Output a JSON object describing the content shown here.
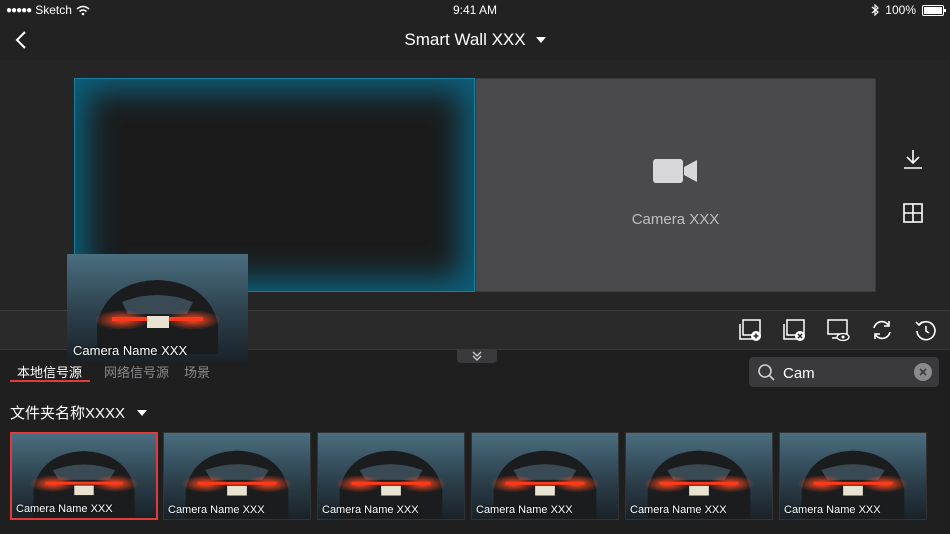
{
  "status": {
    "carrier": "Sketch",
    "time": "9:41 AM",
    "battery": "100%"
  },
  "nav": {
    "title": "Smart Wall XXX"
  },
  "wall": {
    "screen2_label": "Camera XXX"
  },
  "drag": {
    "label": "Camera Name XXX"
  },
  "tabs": [
    {
      "label": "本地信号源",
      "active": true
    },
    {
      "label": "网络信号源",
      "active": false
    },
    {
      "label": "场景",
      "active": false
    }
  ],
  "search": {
    "value": "Cam"
  },
  "folder": {
    "name": "文件夹名称XXXX"
  },
  "thumbnails": [
    {
      "label": "Camera Name XXX",
      "selected": true
    },
    {
      "label": "Camera Name XXX",
      "selected": false
    },
    {
      "label": "Camera Name XXX",
      "selected": false
    },
    {
      "label": "Camera Name XXX",
      "selected": false
    },
    {
      "label": "Camera Name XXX",
      "selected": false
    },
    {
      "label": "Camera Name XXX",
      "selected": false
    }
  ],
  "colors": {
    "accent": "#e23b3b",
    "highlight": "#0d5f7a",
    "background": "#1f1f20"
  }
}
